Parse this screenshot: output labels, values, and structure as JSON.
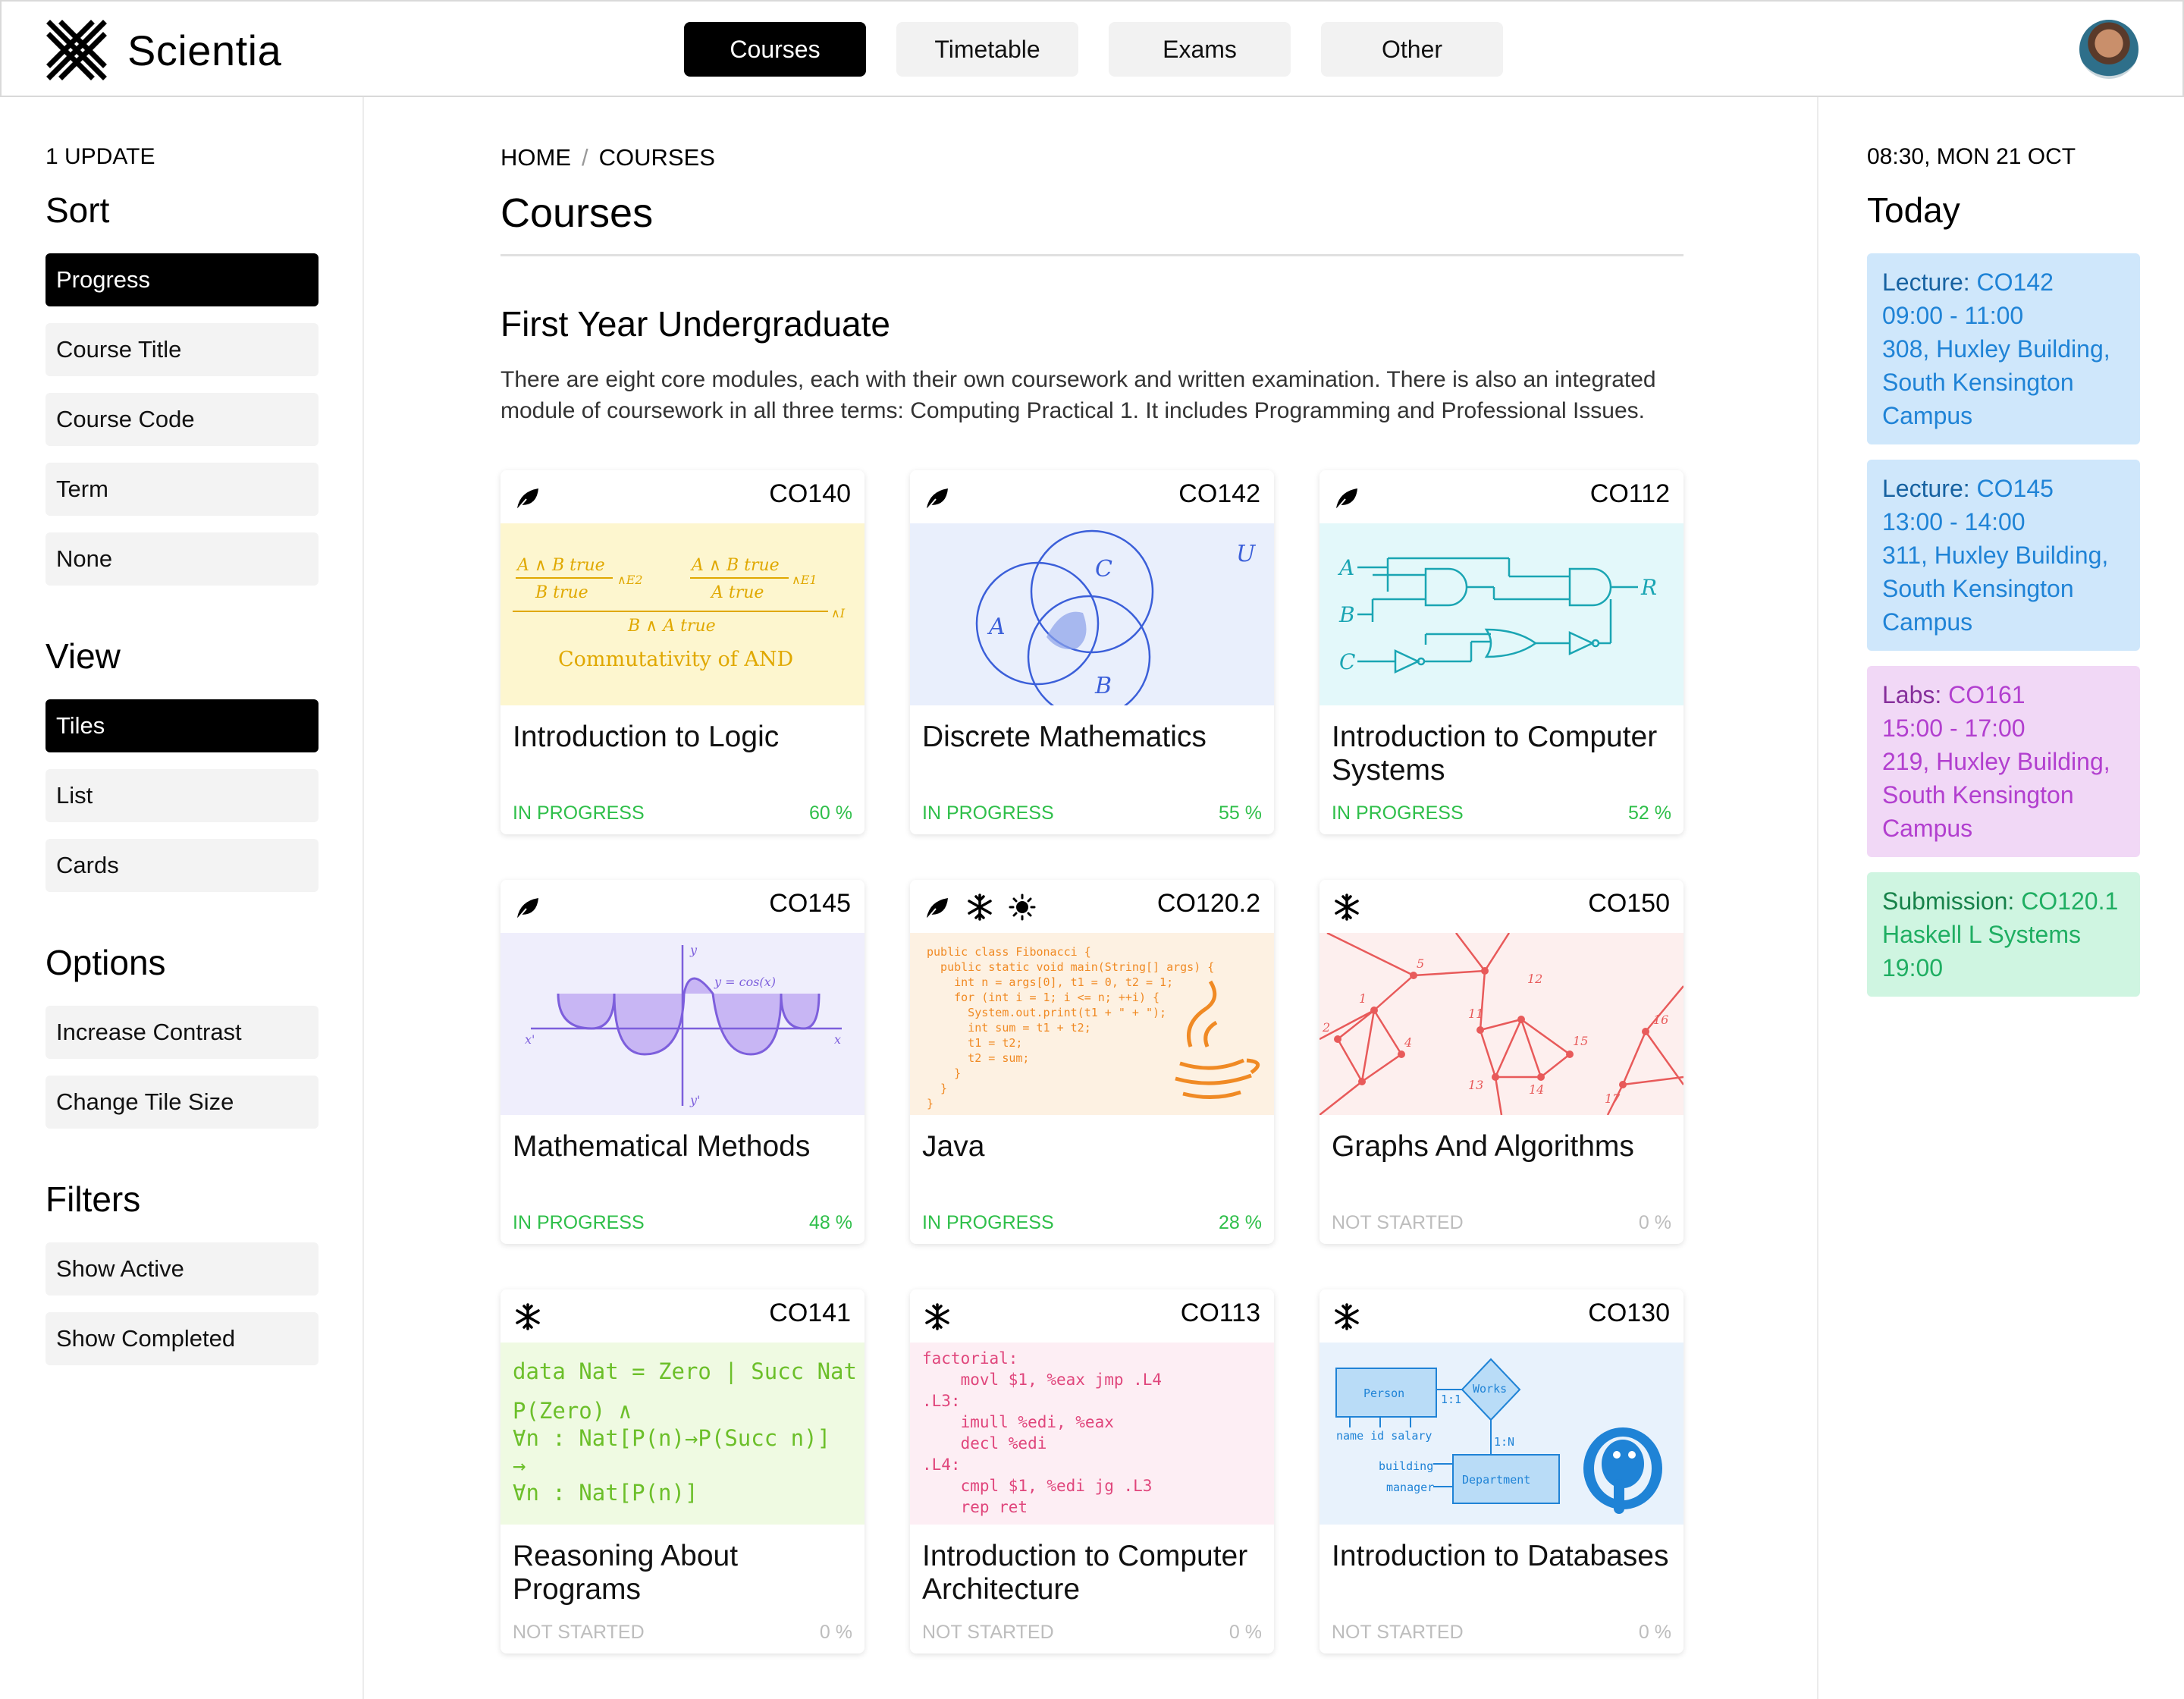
{
  "app": {
    "name": "Scientia"
  },
  "nav": {
    "tabs": [
      "Courses",
      "Timetable",
      "Exams",
      "Other"
    ]
  },
  "left": {
    "updates": "1 UPDATE",
    "sort": {
      "title": "Sort",
      "options": [
        "Progress",
        "Course Title",
        "Course Code",
        "Term",
        "None"
      ],
      "selected": "Progress"
    },
    "view": {
      "title": "View",
      "options": [
        "Tiles",
        "List",
        "Cards"
      ],
      "selected": "Tiles"
    },
    "options": {
      "title": "Options",
      "items": [
        "Increase Contrast",
        "Change Tile Size"
      ]
    },
    "filters": {
      "title": "Filters",
      "items": [
        "Show Active",
        "Show Completed"
      ]
    }
  },
  "breadcrumb": [
    "HOME",
    "/",
    "COURSES"
  ],
  "page_title": "Courses",
  "section": {
    "title": "First Year Undergraduate",
    "description": "There are eight core modules, each with their own coursework and written examination. There is also an integrated module of coursework in all three terms: Computing Practical 1. It includes Programming and Professional Issues."
  },
  "courses": [
    {
      "code": "CO140",
      "title": "Introduction to Logic",
      "status": "IN PROGRESS",
      "progress": "60 %",
      "terms": [
        "leaf"
      ],
      "bg": "#fdf6cf"
    },
    {
      "code": "CO142",
      "title": "Discrete Mathematics",
      "status": "IN PROGRESS",
      "progress": "55 %",
      "terms": [
        "leaf"
      ],
      "bg": "#e9effc"
    },
    {
      "code": "CO112",
      "title": "Introduction to Computer Systems",
      "status": "IN PROGRESS",
      "progress": "52 %",
      "terms": [
        "leaf"
      ],
      "bg": "#e3f8fa"
    },
    {
      "code": "CO145",
      "title": "Mathematical Methods",
      "status": "IN PROGRESS",
      "progress": "48 %",
      "terms": [
        "leaf"
      ],
      "bg": "#efeefc"
    },
    {
      "code": "CO120.2",
      "title": "Java",
      "status": "IN PROGRESS",
      "progress": "28 %",
      "terms": [
        "leaf",
        "snowflake",
        "sun"
      ],
      "bg": "#fdf1e2"
    },
    {
      "code": "CO150",
      "title": "Graphs And Algorithms",
      "status": "NOT STARTED",
      "progress": "0 %",
      "terms": [
        "snowflake"
      ],
      "bg": "#fdefee"
    },
    {
      "code": "CO141",
      "title": "Reasoning About Programs",
      "status": "NOT STARTED",
      "progress": "0 %",
      "terms": [
        "snowflake"
      ],
      "bg": "#effae2"
    },
    {
      "code": "CO113",
      "title": "Introduction to Computer Architecture",
      "status": "NOT STARTED",
      "progress": "0 %",
      "terms": [
        "snowflake"
      ],
      "bg": "#fdeef4"
    },
    {
      "code": "CO130",
      "title": "Introduction to Databases",
      "status": "NOT STARTED",
      "progress": "0 %",
      "terms": [
        "snowflake"
      ],
      "bg": "#e8f2fc"
    }
  ],
  "tile_art": {
    "logic": {
      "l1": "A ∧ B true",
      "l2": "B true",
      "l3": "A ∧ B true",
      "l4": "A true",
      "l5": "B ∧ A true",
      "r1": "∧E2",
      "r2": "∧E1",
      "r3": "∧I",
      "caption": "Commutativity of AND"
    },
    "venn": {
      "a": "A",
      "b": "B",
      "c": "C",
      "u": "U"
    },
    "circuit": {
      "a": "A",
      "b": "B",
      "c": "C",
      "r": "R"
    },
    "cosine": {
      "label": "y = cos(x)",
      "x": "x",
      "xneg": "x'",
      "y": "y",
      "yneg": "y'"
    },
    "java": [
      "public class Fibonacci {",
      "  public static void main(String[] args) {",
      "    int n = args[0], t1 = 0, t2 = 1;",
      "    for (int i = 1; i <= n; ++i) {",
      "      System.out.print(t1 + \" + \");",
      "      int sum = t1 + t2;",
      "      t1 = t2;",
      "      t2 = sum;",
      "    }",
      "  }",
      "}"
    ],
    "graph": [
      "2",
      "1",
      "4",
      "5",
      "11",
      "12",
      "13",
      "14",
      "15",
      "16",
      "17"
    ],
    "haskell": [
      "data Nat = Zero | Succ Nat",
      "P(Zero) ∧",
      "∀n : Nat[P(n)→P(Succ n)]",
      "→",
      "∀n : Nat[P(n)]"
    ],
    "asm": [
      "factorial:",
      "    movl $1, %eax jmp .L4",
      ".L3:",
      "    imull %edi, %eax",
      "    decl %edi",
      ".L4:",
      "    cmpl $1, %edi jg .L3",
      "    rep ret"
    ],
    "er": {
      "person": "Person",
      "works": "Works",
      "department": "Department",
      "one": "1:1",
      "n": "1:N",
      "attrs": "name id salary",
      "building": "building",
      "manager": "manager"
    }
  },
  "right": {
    "datetime": "08:30, MON 21 OCT",
    "title": "Today",
    "events": [
      {
        "type": "Lecture:",
        "code": "CO142",
        "time": "09:00 - 11:00",
        "place1": "308, Huxley Building,",
        "place2": "South Kensington",
        "place3": "Campus",
        "bg": "#cfe7fb",
        "fg": "#1f83d6"
      },
      {
        "type": "Lecture:",
        "code": "CO145",
        "time": "13:00 - 14:00",
        "place1": "311, Huxley Building,",
        "place2": "South Kensington",
        "place3": "Campus",
        "bg": "#cfe7fb",
        "fg": "#1f83d6"
      },
      {
        "type": "Labs:",
        "code": "CO161",
        "time": "15:00 - 17:00",
        "place1": "219, Huxley Building,",
        "place2": "South Kensington",
        "place3": "Campus",
        "bg": "#f1d8f6",
        "fg": "#b23fcf"
      },
      {
        "type": "Submission:",
        "code": "CO120.1",
        "time": "Haskell L Systems",
        "place1": "19:00",
        "place2": "",
        "place3": "",
        "bg": "#cff5e1",
        "fg": "#1fae62"
      }
    ]
  }
}
